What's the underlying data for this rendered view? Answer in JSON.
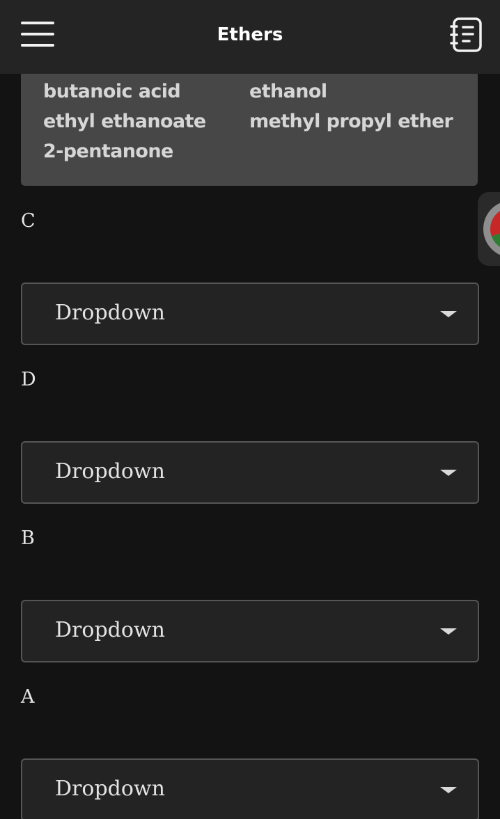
{
  "header": {
    "title": "Ethers",
    "menu_icon": "hamburger-menu-icon",
    "notes_icon": "notebook-icon"
  },
  "word_bank": {
    "items": [
      "butanoic acid",
      "ethanol",
      "ethyl ethanoate",
      "methyl propyl ether",
      "2-pentanone"
    ]
  },
  "questions": [
    {
      "label": "C",
      "dropdown": "Dropdown"
    },
    {
      "label": "D",
      "dropdown": "Dropdown"
    },
    {
      "label": "B",
      "dropdown": "Dropdown"
    },
    {
      "label": "A",
      "dropdown": "Dropdown"
    }
  ],
  "colors": {
    "background": "#131313",
    "header": "#242424",
    "card": "#474747",
    "dropdown_bg": "#232323",
    "dropdown_border": "#555555"
  }
}
